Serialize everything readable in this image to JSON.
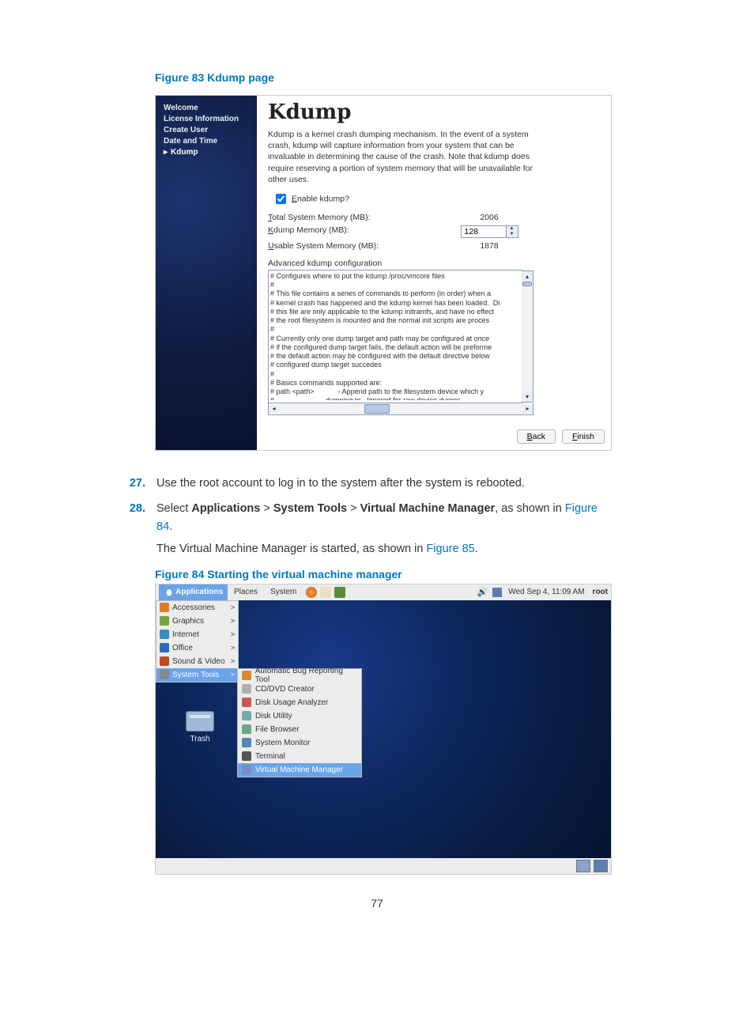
{
  "page_number": "77",
  "fig83": {
    "caption": "Figure 83 Kdump page",
    "sidebar": [
      "Welcome",
      "License Information",
      "Create User",
      "Date and Time",
      "Kdump"
    ],
    "sidebar_current": 4,
    "title": "Kdump",
    "desc": "Kdump is a kernel crash dumping mechanism. In the event of a system crash, kdump will capture information from your system that can be invaluable in determining the cause of the crash. Note that kdump does require reserving a portion of system memory that will be unavailable for other uses.",
    "enable_label": "Enable kdump?",
    "enable_checked": true,
    "mem": {
      "total_label": "Total System Memory (MB):",
      "total_value": "2006",
      "kdump_label": "Kdump Memory (MB):",
      "kdump_value": "128",
      "usable_label": "Usable System Memory (MB):",
      "usable_value": "1878"
    },
    "adv_label": "Advanced kdump configuration",
    "config_text": "# Configures where to put the kdump /proc/vmcore files\n#\n# This file contains a series of commands to perform (in order) when a\n# kernel crash has happened and the kdump kernel has been loaded.  Di\n# this file are only applicable to the kdump initramfs, and have no effect\n# the root filesystem is mounted and the normal init scripts are proces\n#\n# Currently only one dump target and path may be configured at once\n# if the configured dump target fails, the default action will be preforme\n# the default action may be configured with the default directive below\n# configured dump target succedes\n#\n# Basics commands supported are:\n# path <path>            - Append path to the filesystem device which y\n#                          dumping to.  Ignored for raw device dumps.\n#                          If unset, will default to /var/crash.",
    "buttons": {
      "back": "Back",
      "finish": "Finish"
    }
  },
  "steps": [
    {
      "num": "27.",
      "text_plain": "Use the root account to log in to the system after the system is rebooted."
    },
    {
      "num": "28.",
      "text_main": "Select ",
      "bold1": "Applications",
      "gt1": " > ",
      "bold2": "System Tools",
      "gt2": " > ",
      "bold3": "Virtual Machine Manager",
      "tail": ", as shown in ",
      "link1": "Figure 84",
      "period": ".",
      "sub_pre": "The Virtual Machine Manager is started, as shown in ",
      "link2": "Figure 85",
      "sub_period": "."
    }
  ],
  "fig84": {
    "caption": "Figure 84 Starting the virtual machine manager",
    "menubar": {
      "applications": "Applications",
      "places": "Places",
      "system": "System",
      "clock": "Wed Sep  4, 11:09 AM",
      "user": "root"
    },
    "app_menu": [
      {
        "label": "Accessories",
        "icon": "#e07a2a"
      },
      {
        "label": "Graphics",
        "icon": "#7aa23a"
      },
      {
        "label": "Internet",
        "icon": "#3a8cc0"
      },
      {
        "label": "Office",
        "icon": "#2c6cc0"
      },
      {
        "label": "Sound & Video",
        "icon": "#c04a2a"
      },
      {
        "label": "System Tools",
        "icon": "#888",
        "selected": true
      }
    ],
    "desk_icon": "Trash",
    "submenu": [
      {
        "label": "Automatic Bug Reporting Tool",
        "icon": "#d98a2a"
      },
      {
        "label": "CD/DVD Creator",
        "icon": "#b0b0b0"
      },
      {
        "label": "Disk Usage Analyzer",
        "icon": "#c55"
      },
      {
        "label": "Disk Utility",
        "icon": "#7aa"
      },
      {
        "label": "File Browser",
        "icon": "#6a8"
      },
      {
        "label": "System Monitor",
        "icon": "#58a"
      },
      {
        "label": "Terminal",
        "icon": "#555"
      },
      {
        "label": "Virtual Machine Manager",
        "icon": "#7a8cc0",
        "selected": true
      }
    ]
  }
}
